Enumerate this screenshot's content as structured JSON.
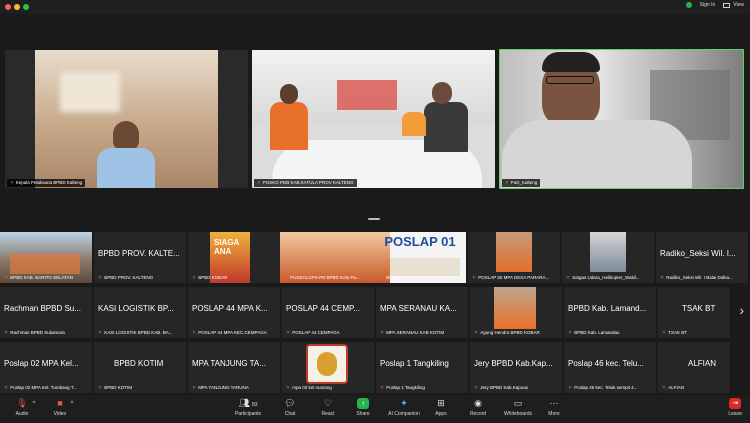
{
  "titlebar": {
    "sign_in": "Sign In",
    "view": "View"
  },
  "speakers": [
    {
      "label": "Kepala Pelaksana BPBD Kalteng"
    },
    {
      "label": "POSKO PDB KAB.KATULA PROV KALTENG"
    },
    {
      "label": "PuD_Kalteng"
    }
  ],
  "gallery": {
    "row1": [
      {
        "name": "",
        "sub": "BPBD KAB. BARITO SELATAN"
      },
      {
        "name": "BPBD PROV. KALTE...",
        "sub": "BPBD PROV. KALTENG"
      },
      {
        "name": "",
        "sub": "BPBD KOBAR",
        "banner": "SIAGA ANA"
      },
      {
        "name": "",
        "sub": "PUSDALOPS-PB BPBD Kota Pa...",
        "banner": "POSLAP 01"
      },
      {
        "name": "",
        "sub": "Bumiru"
      },
      {
        "name": "",
        "sub": "POSLAP 50 MPA DESA PARARA..."
      },
      {
        "name": "",
        "sub": "Satgas Udara_Helikopter_Wakil..."
      },
      {
        "name": "Radiko_Seksi Wil. I...",
        "sub": "Radiko_Seksi Wil. I Balai Dalka..."
      }
    ],
    "row2": [
      {
        "name": "Rachman BPBD Su...",
        "sub": "Rachman BPBD Sukamara"
      },
      {
        "name": "KASI LOGISTIK BP...",
        "sub": "KASI LOGISTIK BPBD KAB. BA..."
      },
      {
        "name": "POSLAP 44 MPA K...",
        "sub": "POSLAP 44 MPA KEC.CEMPAGA"
      },
      {
        "name": "POSLAP 44 CEMP...",
        "sub": "POSLAP 44 CEMPAGA"
      },
      {
        "name": "MPA SERANAU KA...",
        "sub": "MPA SERANAU KAB KOTIM"
      },
      {
        "name": "",
        "sub": "Agung Hendra BPBD KOBAR"
      },
      {
        "name": "BPBD Kab. Lamand...",
        "sub": "BPBD Kab. Lamandau"
      },
      {
        "name": "TSAK BT",
        "sub": "TSAK BT"
      }
    ],
    "row3": [
      {
        "name": "Poslap 02 MPA Kel...",
        "sub": "Poslap 02 MPA Kel. Tumbang T..."
      },
      {
        "name": "BPBD KOTIM",
        "sub": "BPBD KOTIM"
      },
      {
        "name": "MPA TANJUNG TA...",
        "sub": "MPA TANJUNG TARUNA"
      },
      {
        "name": "",
        "sub": "mpa 03 kel.mariang"
      },
      {
        "name": "Poslap 1 Tangkiling",
        "sub": "Poslap 1 Tangkiling"
      },
      {
        "name": "Jery BPBD Kab.Kap...",
        "sub": "Jery BPBD Kab.Kapuas"
      },
      {
        "name": "Poslap 46 kec. Telu...",
        "sub": "Poslap 46 kec. Teluk sempit 4..."
      },
      {
        "name": "ALFIAN",
        "sub": "ALFIAN"
      }
    ]
  },
  "toolbar": {
    "audio": "Audio",
    "video": "Video",
    "participants": "Participants",
    "participants_count": "83",
    "chat": "Chat",
    "react": "React",
    "share": "Share",
    "ai_companion": "AI Companion",
    "apps": "Apps",
    "record": "Record",
    "whiteboards": "Whiteboards",
    "more": "More",
    "leave": "Leave"
  },
  "colors": {
    "accent_green": "#2bb24c",
    "mute_red": "#e5534b",
    "leave_red": "#e02828",
    "active_speaker": "#5fd35f"
  }
}
